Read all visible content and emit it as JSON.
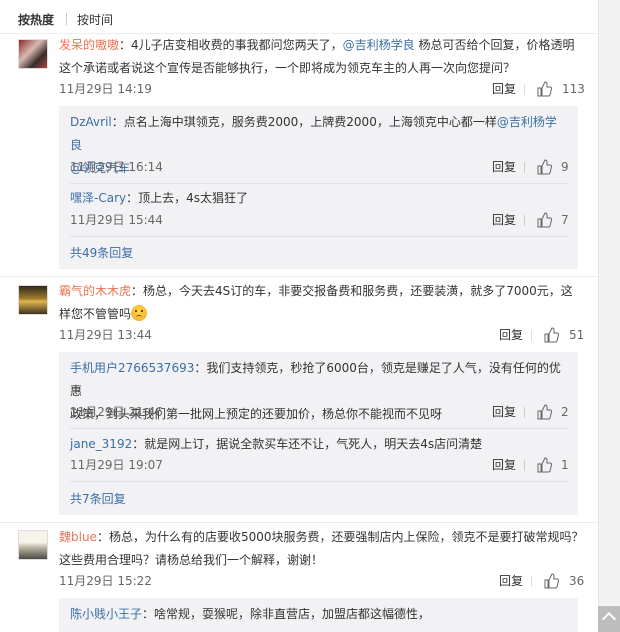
{
  "sort": {
    "hot_label": "按热度",
    "time_label": "按时间"
  },
  "actions": {
    "reply_label": "回复"
  },
  "comments": [
    {
      "username": "发呆的嗷嗷",
      "text_before": "：4儿子店变相收费的事我都问您两天了，",
      "mention": "@吉利杨学良",
      "text_after_line1": " 杨总可否给个回复，价格透明",
      "text_line2": "这个承诺或者说这个宣传是否能够执行，一个即将成为领克车主的人再一次向您提问？",
      "date": "11月29日 14:19",
      "likes": "113",
      "replies": [
        {
          "username": "DzAvril",
          "text_line1_before": "：点名上海中琪领克，服务费2000，上牌费2000，上海领克中心都一样",
          "mention1": "@吉利杨学良",
          "mention2": "@领克汽车",
          "date": "11月29日 16:14",
          "likes": "9"
        },
        {
          "username": "嘿泽-Cary",
          "text": "：顶上去，4s太猖狂了",
          "date": "11月29日 15:44",
          "likes": "7"
        }
      ],
      "more_label": "共49条回复"
    },
    {
      "username": "霸气的木木虎",
      "text_line1": "：杨总，今天去4S订的车，非要交报备费和服务费，还要装潢，就多了7000元，这",
      "text_line2": "样您不管管吗",
      "emoji": "face-emoji",
      "date": "11月29日 13:44",
      "likes": "51",
      "replies": [
        {
          "username": "手机用户2766537693",
          "text_line1": "：我们支持领克，秒抢了6000台，领克是赚足了人气，没有任何的优惠",
          "text_line2": "政策，到头来我们第一批网上预定的还要加价，杨总你不能视而不见呀",
          "date": "11月29日 21:46",
          "likes": "2"
        },
        {
          "username": "jane_3192",
          "text": "：就是网上订，据说全款买车还不让，气死人，明天去4s店问清楚",
          "date": "11月29日 19:07",
          "likes": "1"
        }
      ],
      "more_label": "共7条回复"
    },
    {
      "username": "魏blue",
      "text_line1": "：杨总，为什么有的店要收5000块服务费，还要强制店内上保险，领克不是要打破常规吗？",
      "text_line2": "这些费用合理吗？请杨总给我们一个解释，谢谢！",
      "date": "11月29日 15:22",
      "likes": "36",
      "replies": [
        {
          "username": "陈小贱小王子",
          "text": "：啥常规，耍猴呢，除非直营店，加盟店都这幅德性，"
        }
      ]
    }
  ],
  "colors": {
    "username": "#eb7350",
    "link": "#3a6ea5",
    "sub_bg": "#f2f2f5"
  },
  "icons": {
    "like": "thumbs-up-icon",
    "scroll_top": "chevron-up-icon"
  }
}
